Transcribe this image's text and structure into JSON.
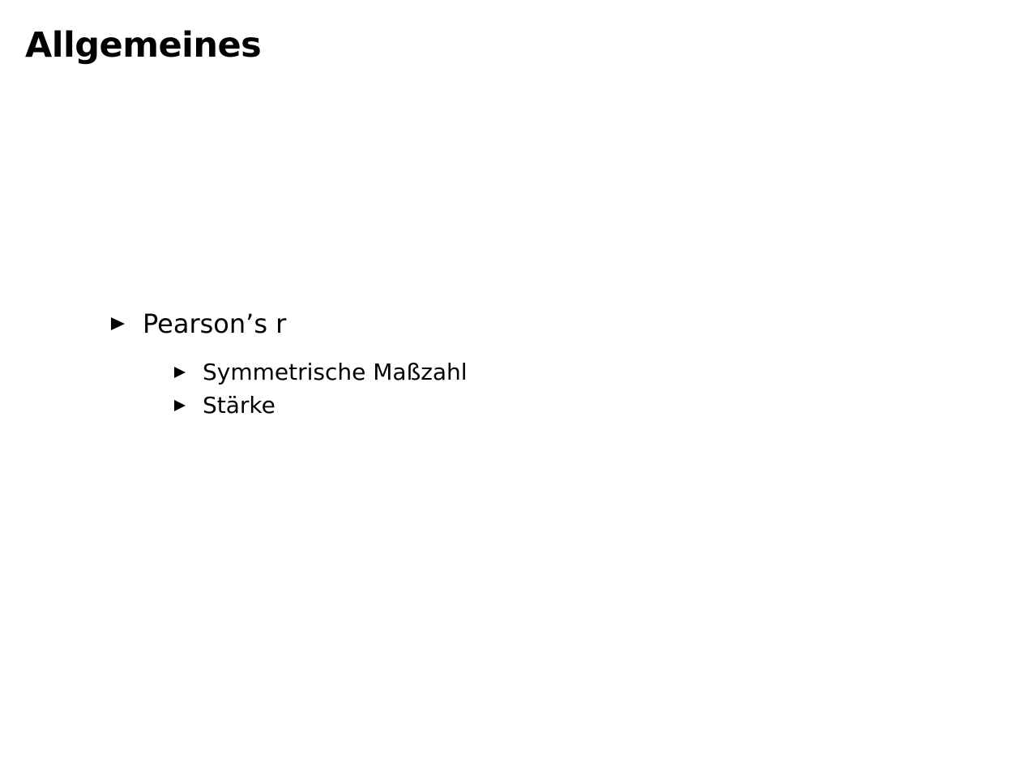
{
  "frame": {
    "title": "Allgemeines"
  },
  "content": {
    "items": [
      {
        "label": "Pearson’s r",
        "bullet_icon": "triangle-right-icon",
        "subitems": [
          {
            "label": "Symmetrische Maßzahl",
            "bullet_icon": "triangle-right-icon"
          },
          {
            "label": "Stärke",
            "bullet_icon": "triangle-right-icon"
          }
        ]
      }
    ]
  }
}
